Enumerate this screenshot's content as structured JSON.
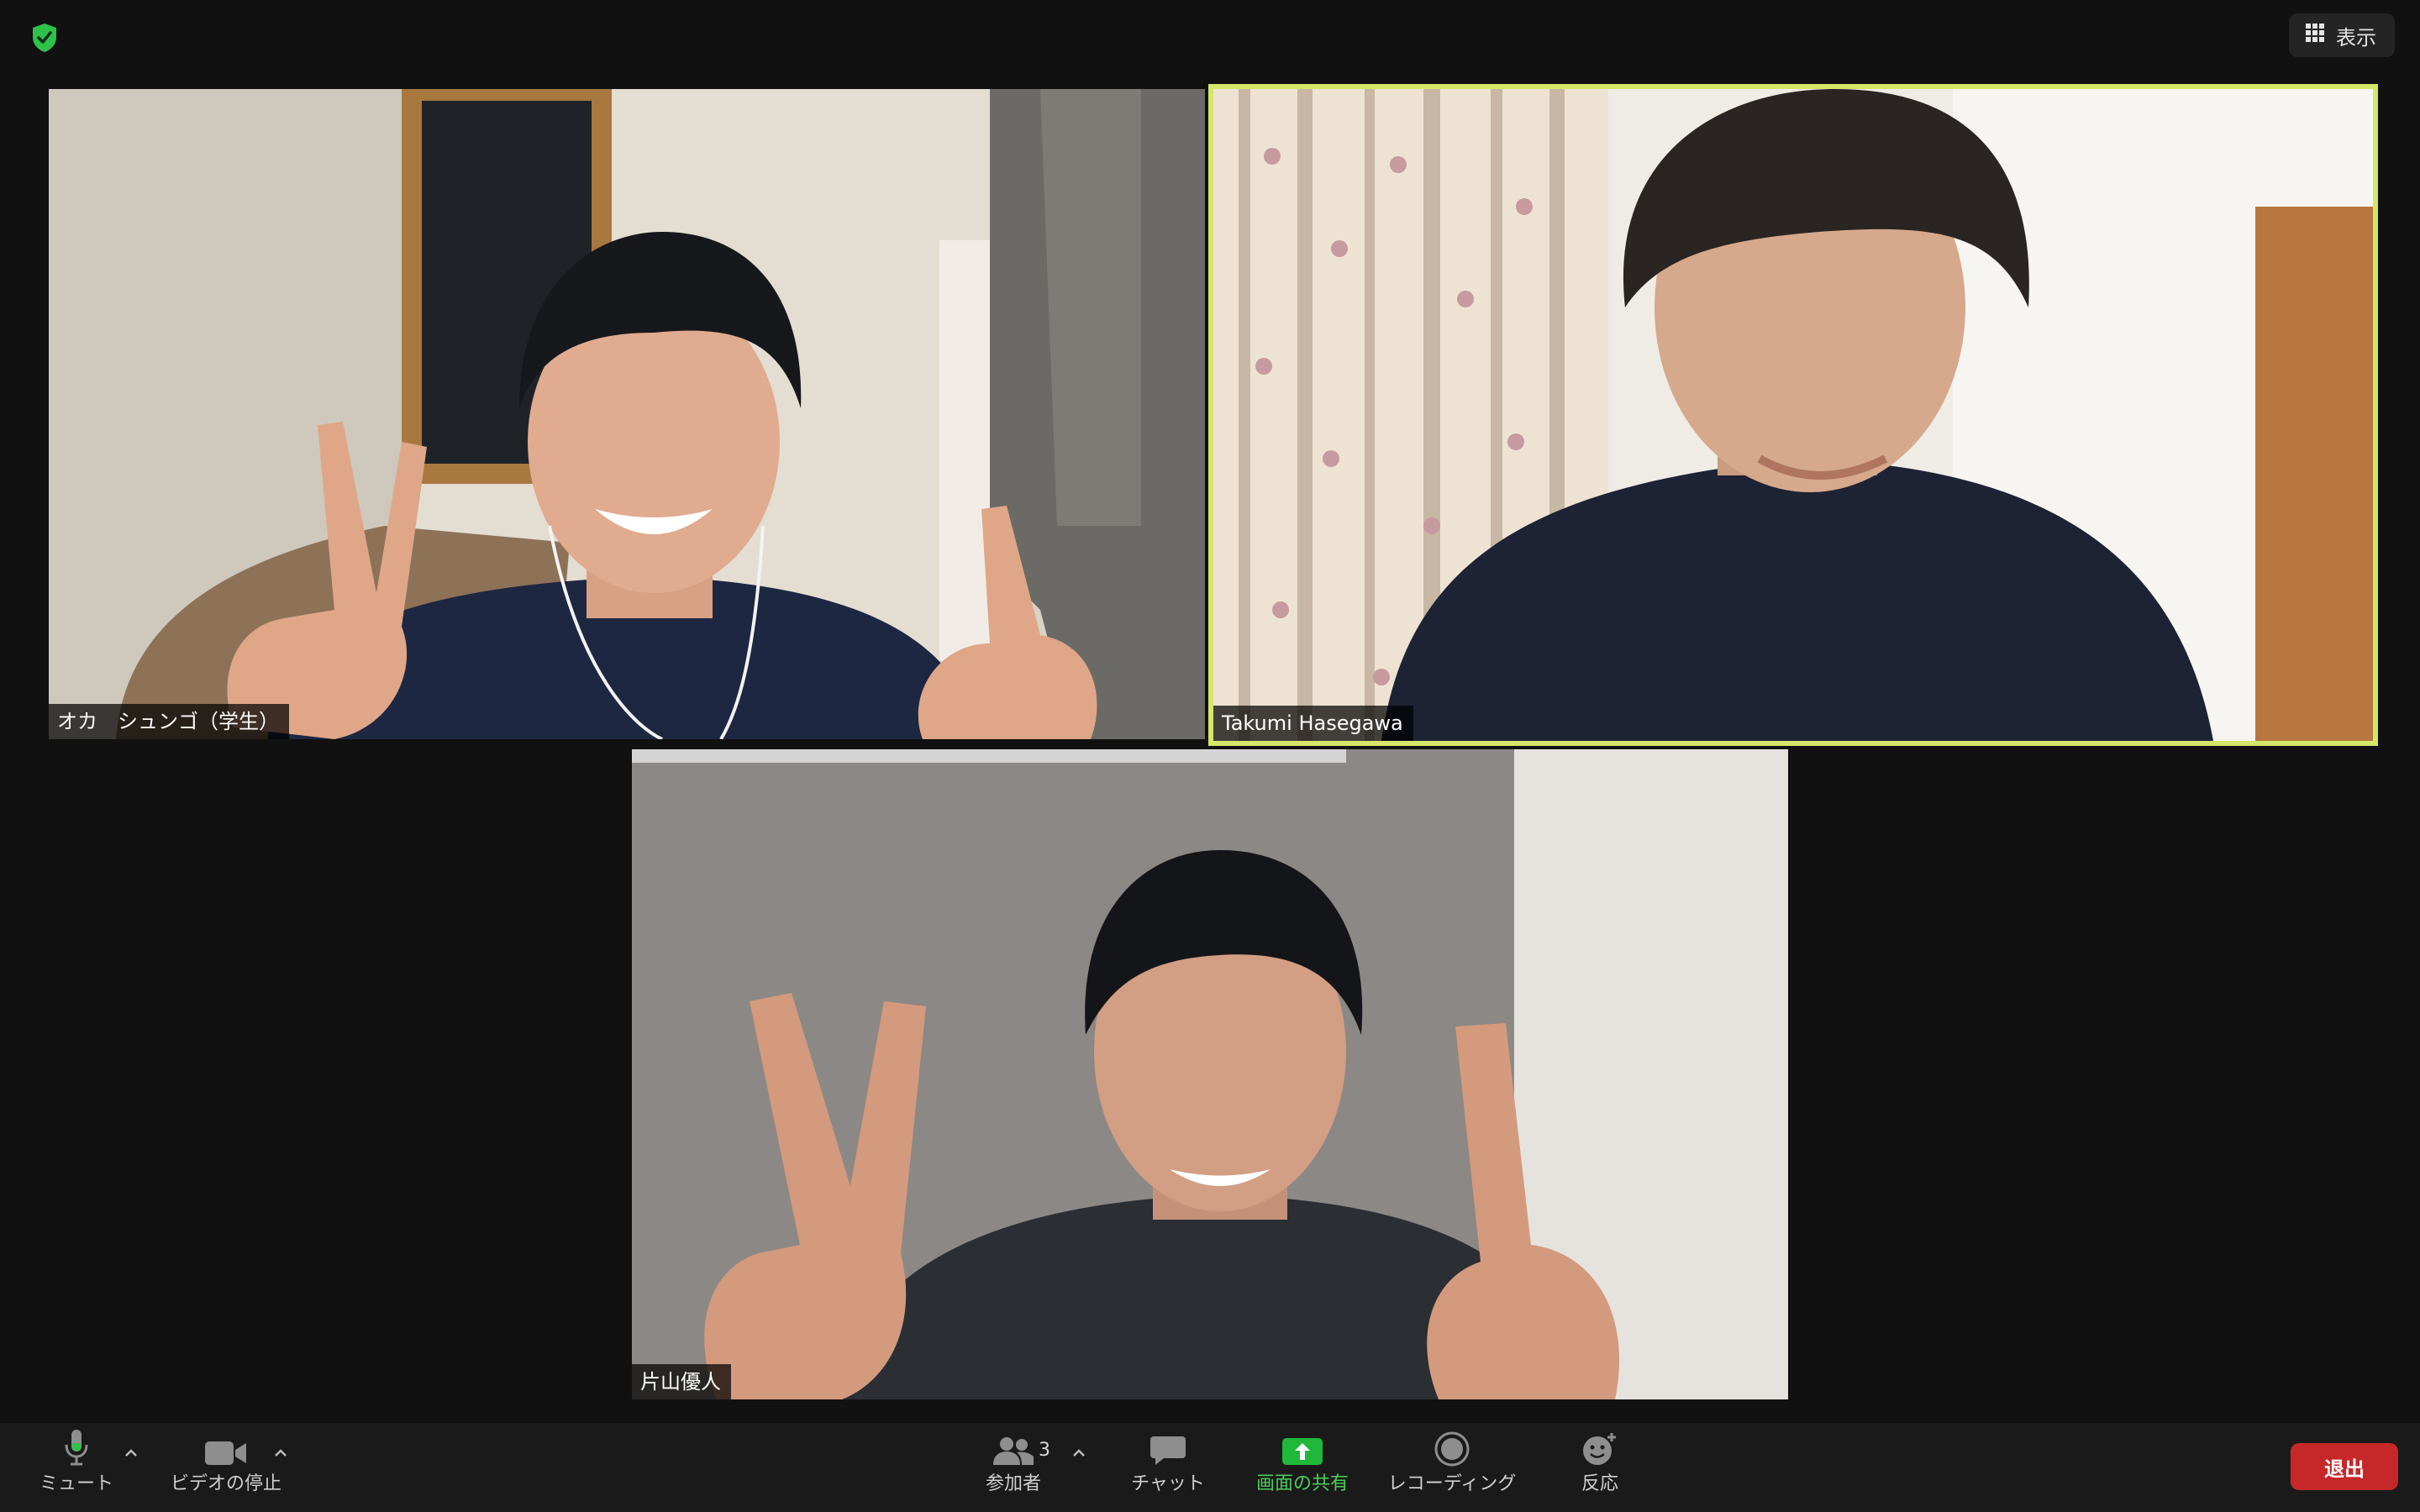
{
  "top_bar": {
    "security_icon": "shield-check-icon",
    "view_label": "表示",
    "view_icon": "grid-icon"
  },
  "participants": [
    {
      "name": "オカ　シュンゴ（学生）",
      "active_speaker": false
    },
    {
      "name": "Takumi Hasegawa",
      "active_speaker": true
    },
    {
      "name": "片山優人",
      "active_speaker": false
    }
  ],
  "toolbar": {
    "mute_label": "ミュート",
    "video_label": "ビデオの停止",
    "participants_label": "参加者",
    "participants_count": "3",
    "chat_label": "チャット",
    "share_label": "画面の共有",
    "record_label": "レコーディング",
    "reactions_label": "反応",
    "leave_label": "退出"
  },
  "colors": {
    "active_speaker_border": "#d6e66a",
    "share_green": "#1fb83a",
    "leave_red": "#c6282a",
    "security_green": "#2ec24a"
  }
}
